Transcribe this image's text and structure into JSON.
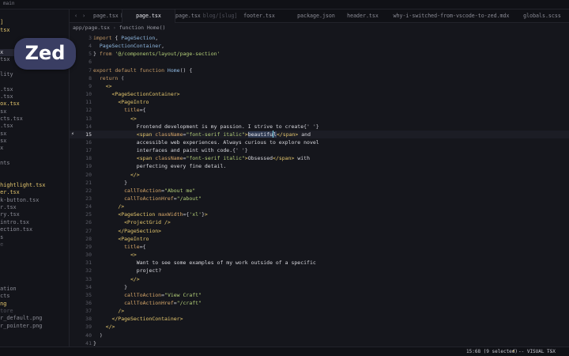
{
  "titlebar": {
    "branch": "main"
  },
  "sidebar": {
    "items": [
      {
        "label": "e",
        "color": "yellow"
      },
      {
        "label": "ug]",
        "color": "yellow"
      },
      {
        "label": "e.tsx",
        "color": "yellow"
      },
      {
        "label": "x",
        "color": "dim"
      },
      {
        "label": "x",
        "color": "dim"
      },
      {
        "label": "tsx",
        "color": "white",
        "selected": true
      },
      {
        "label": "e.tsx",
        "color": "dim"
      },
      {
        "label": "s",
        "color": "dim"
      },
      {
        "label": "bility",
        "color": "dim"
      },
      {
        "label": "",
        "color": "dim"
      },
      {
        "label": "on.tsx",
        "color": "dim"
      },
      {
        "label": "ge.tsx",
        "color": "dim"
      },
      {
        "label": "tbox.tsx",
        "color": "yellow"
      },
      {
        "label": ".tsx",
        "color": "dim"
      },
      {
        "label": "jects.tsx",
        "color": "dim"
      },
      {
        "label": "er.tsx",
        "color": "dim"
      },
      {
        "label": ".tsx",
        "color": "dim"
      },
      {
        "label": ".tsx",
        "color": "dim"
      },
      {
        "label": "tsx",
        "color": "dim"
      },
      {
        "label": "y",
        "color": "dim"
      },
      {
        "label": "ments",
        "color": "dim"
      },
      {
        "label": "",
        "color": "dim"
      },
      {
        "label": "",
        "color": "dim"
      },
      {
        "label": "e-hightlight.tsx",
        "color": "yellow"
      },
      {
        "label": "oter.tsx",
        "color": "yellow"
      },
      {
        "label": "ack-button.tsx",
        "color": "dim"
      },
      {
        "label": "der.tsx",
        "color": "dim"
      },
      {
        "label": "onry.tsx",
        "color": "dim"
      },
      {
        "label": "e-intro.tsx",
        "color": "dim"
      },
      {
        "label": "-section.tsx",
        "color": "dim"
      },
      {
        "label": "ers",
        "color": "dim"
      },
      {
        "label": "ule",
        "color": "faint"
      },
      {
        "label": "",
        "color": "dim"
      },
      {
        "label": "",
        "color": "dim"
      },
      {
        "label": "",
        "color": "dim"
      },
      {
        "label": "",
        "color": "dim"
      },
      {
        "label": "ft",
        "color": "dim"
      },
      {
        "label": "iration",
        "color": "dim"
      },
      {
        "label": "jects",
        "color": "dim"
      },
      {
        "label": "ting",
        "color": "yellow"
      },
      {
        "label": "_Store",
        "color": "faint"
      },
      {
        "label": "sor_default.png",
        "color": "dim"
      },
      {
        "label": "sor_pointer.png",
        "color": "dim"
      }
    ]
  },
  "logo": {
    "text": "Zed"
  },
  "tabs": {
    "back": "‹",
    "forward": "›",
    "items": [
      {
        "label": "page.tsx",
        "suffix": "blog",
        "active": false
      },
      {
        "label": "page.tsx",
        "suffix": "",
        "active": true
      },
      {
        "label": "page.tsx",
        "suffix": "blog/[slug]",
        "active": false
      },
      {
        "label": "footer.tsx",
        "suffix": "",
        "active": false
      },
      {
        "label": "package.json",
        "suffix": "",
        "active": false
      },
      {
        "label": "header.tsx",
        "suffix": "",
        "active": false
      },
      {
        "label": "why-i-switched-from-vscode-to-zed.mdx",
        "suffix": "",
        "active": false
      },
      {
        "label": "globals.scss",
        "suffix": "",
        "active": false
      }
    ]
  },
  "breadcrumb": {
    "path": "app/page.tsx",
    "separator": "›",
    "symbol": "function Home()"
  },
  "editor": {
    "current_line": 15,
    "lines": [
      {
        "n": "3",
        "tokens": [
          [
            "kw",
            "import "
          ],
          [
            "plain",
            "{ "
          ],
          [
            "fn",
            "PageSection"
          ],
          [
            "pun",
            ","
          ]
        ]
      },
      {
        "n": "4",
        "tokens": [
          [
            "plain",
            "  "
          ],
          [
            "fn",
            "PageSectionContainer"
          ],
          [
            "pun",
            ","
          ]
        ]
      },
      {
        "n": "5",
        "tokens": [
          [
            "pun",
            "} "
          ],
          [
            "kw",
            "from "
          ],
          [
            "str",
            "'@/components/layout/page-section'"
          ]
        ]
      },
      {
        "n": "6",
        "tokens": []
      },
      {
        "n": "7",
        "tokens": [
          [
            "kw",
            "export default function "
          ],
          [
            "fn",
            "Home"
          ],
          [
            "pun",
            "() {"
          ]
        ]
      },
      {
        "n": "8",
        "tokens": [
          [
            "plain",
            "  "
          ],
          [
            "kw",
            "return "
          ],
          [
            "pun",
            "("
          ]
        ]
      },
      {
        "n": "9",
        "tokens": [
          [
            "plain",
            "    "
          ],
          [
            "tag",
            "<>"
          ]
        ]
      },
      {
        "n": "10",
        "tokens": [
          [
            "plain",
            "      "
          ],
          [
            "tag",
            "<PageSectionContainer>"
          ]
        ]
      },
      {
        "n": "11",
        "tokens": [
          [
            "plain",
            "        "
          ],
          [
            "tag",
            "<PageIntro"
          ]
        ]
      },
      {
        "n": "12",
        "tokens": [
          [
            "plain",
            "          "
          ],
          [
            "attr",
            "title"
          ],
          [
            "pun",
            "={"
          ]
        ]
      },
      {
        "n": "13",
        "tokens": [
          [
            "plain",
            "            "
          ],
          [
            "tag",
            "<>"
          ]
        ]
      },
      {
        "n": "14",
        "tokens": [
          [
            "plain",
            "              "
          ],
          [
            "txt",
            "Frontend development is my passion. I strive to create"
          ],
          [
            "pun",
            "{' '}"
          ]
        ]
      },
      {
        "n": "15",
        "tokens": [
          [
            "plain",
            "              "
          ],
          [
            "tag",
            "<span "
          ],
          [
            "attr",
            "className"
          ],
          [
            "pun",
            "="
          ],
          [
            "str",
            "\"font-serif italic\""
          ],
          [
            "tag",
            ">"
          ],
          [
            "hl",
            "beautifu"
          ],
          [
            "caret",
            ""
          ],
          [
            "hl",
            "l"
          ],
          [
            "tag",
            "</span>"
          ],
          [
            "txt",
            " and"
          ]
        ]
      },
      {
        "n": "16",
        "tokens": [
          [
            "plain",
            "              "
          ],
          [
            "txt",
            "accessible web experiences. Always curious to explore novel"
          ]
        ]
      },
      {
        "n": "17",
        "tokens": [
          [
            "plain",
            "              "
          ],
          [
            "txt",
            "interfaces and paint with code."
          ],
          [
            "pun",
            "{' '}"
          ]
        ]
      },
      {
        "n": "18",
        "tokens": [
          [
            "plain",
            "              "
          ],
          [
            "tag",
            "<span "
          ],
          [
            "attr",
            "className"
          ],
          [
            "pun",
            "="
          ],
          [
            "str",
            "\"font-serif italic\""
          ],
          [
            "tag",
            ">"
          ],
          [
            "txt",
            "Obsessed"
          ],
          [
            "tag",
            "</span>"
          ],
          [
            "txt",
            " with"
          ]
        ]
      },
      {
        "n": "19",
        "tokens": [
          [
            "plain",
            "              "
          ],
          [
            "txt",
            "perfecting every fine detail."
          ]
        ]
      },
      {
        "n": "20",
        "tokens": [
          [
            "plain",
            "            "
          ],
          [
            "tag",
            "</>"
          ]
        ]
      },
      {
        "n": "21",
        "tokens": [
          [
            "plain",
            "          "
          ],
          [
            "pun",
            "}"
          ]
        ]
      },
      {
        "n": "22",
        "tokens": [
          [
            "plain",
            "          "
          ],
          [
            "attr",
            "callToAction"
          ],
          [
            "pun",
            "="
          ],
          [
            "str",
            "\"About me\""
          ]
        ]
      },
      {
        "n": "23",
        "tokens": [
          [
            "plain",
            "          "
          ],
          [
            "attr",
            "callToActionHref"
          ],
          [
            "pun",
            "="
          ],
          [
            "str",
            "\"/about\""
          ]
        ]
      },
      {
        "n": "24",
        "tokens": [
          [
            "plain",
            "        "
          ],
          [
            "tag",
            "/>"
          ]
        ]
      },
      {
        "n": "25",
        "tokens": [
          [
            "plain",
            "        "
          ],
          [
            "tag",
            "<PageSection "
          ],
          [
            "attr",
            "maxWidth"
          ],
          [
            "pun",
            "={"
          ],
          [
            "str",
            "'xl'"
          ],
          [
            "pun",
            "}"
          ],
          [
            "tag",
            ">"
          ]
        ]
      },
      {
        "n": "26",
        "tokens": [
          [
            "plain",
            "          "
          ],
          [
            "tag",
            "<ProjectGrid />"
          ]
        ]
      },
      {
        "n": "27",
        "tokens": [
          [
            "plain",
            "        "
          ],
          [
            "tag",
            "</PageSection>"
          ]
        ]
      },
      {
        "n": "28",
        "tokens": [
          [
            "plain",
            "        "
          ],
          [
            "tag",
            "<PageIntro"
          ]
        ]
      },
      {
        "n": "29",
        "tokens": [
          [
            "plain",
            "          "
          ],
          [
            "attr",
            "title"
          ],
          [
            "pun",
            "={"
          ]
        ]
      },
      {
        "n": "30",
        "tokens": [
          [
            "plain",
            "            "
          ],
          [
            "tag",
            "<>"
          ]
        ]
      },
      {
        "n": "31",
        "tokens": [
          [
            "plain",
            "              "
          ],
          [
            "txt",
            "Want to see some examples of my work outside of a specific"
          ]
        ]
      },
      {
        "n": "32",
        "tokens": [
          [
            "plain",
            "              "
          ],
          [
            "txt",
            "project?"
          ]
        ]
      },
      {
        "n": "33",
        "tokens": [
          [
            "plain",
            "            "
          ],
          [
            "tag",
            "</>"
          ]
        ]
      },
      {
        "n": "34",
        "tokens": [
          [
            "plain",
            "          "
          ],
          [
            "pun",
            "}"
          ]
        ]
      },
      {
        "n": "35",
        "tokens": [
          [
            "plain",
            "          "
          ],
          [
            "attr",
            "callToAction"
          ],
          [
            "pun",
            "="
          ],
          [
            "str",
            "\"View Craft\""
          ]
        ]
      },
      {
        "n": "36",
        "tokens": [
          [
            "plain",
            "          "
          ],
          [
            "attr",
            "callToActionHref"
          ],
          [
            "pun",
            "="
          ],
          [
            "str",
            "\"/craft\""
          ]
        ]
      },
      {
        "n": "37",
        "tokens": [
          [
            "plain",
            "        "
          ],
          [
            "tag",
            "/>"
          ]
        ]
      },
      {
        "n": "38",
        "tokens": [
          [
            "plain",
            "      "
          ],
          [
            "tag",
            "</PageSectionContainer>"
          ]
        ]
      },
      {
        "n": "39",
        "tokens": [
          [
            "plain",
            "    "
          ],
          [
            "tag",
            "</>"
          ]
        ]
      },
      {
        "n": "40",
        "tokens": [
          [
            "plain",
            "  "
          ],
          [
            "pun",
            ")"
          ]
        ]
      },
      {
        "n": "41",
        "tokens": [
          [
            "pun",
            "}"
          ]
        ]
      }
    ]
  },
  "statusbar": {
    "cursor": "15:68 (9 selected)",
    "diagnostics": "•",
    "mode": "-- VISUAL --",
    "language": "TSX"
  }
}
